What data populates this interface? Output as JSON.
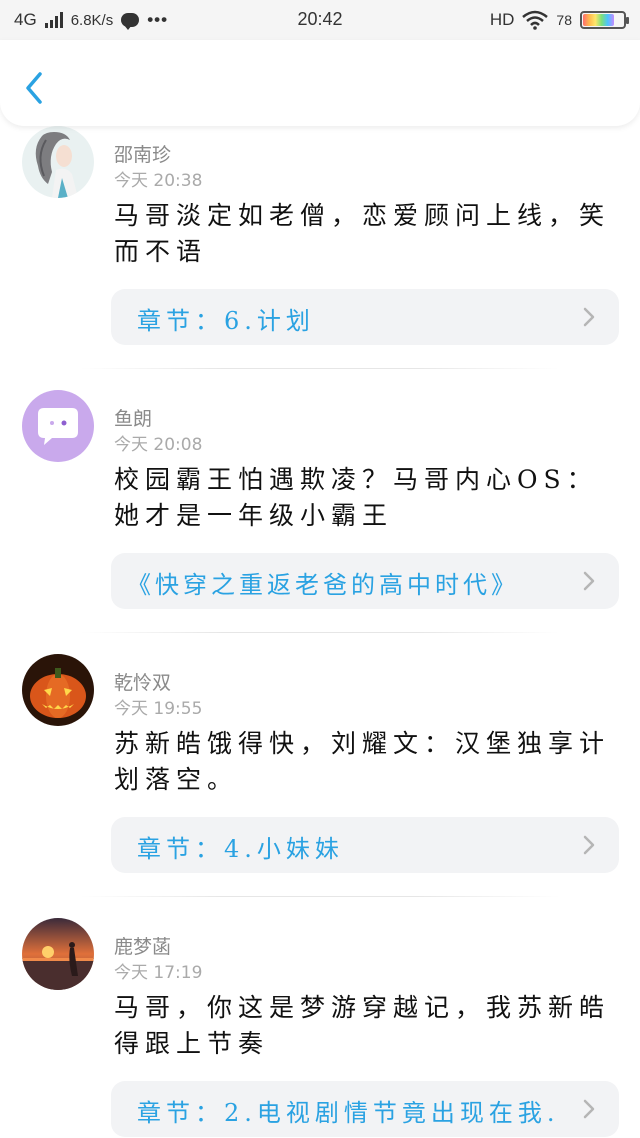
{
  "status_bar": {
    "network": "4G",
    "speed": "6.8K/s",
    "dots": "•••",
    "time": "20:42",
    "hd": "HD",
    "battery": "78"
  },
  "colors": {
    "link": "#2aa2e2",
    "back_arrow": "#2aa2e2",
    "link_bg": "#f2f3f5"
  },
  "comments": [
    {
      "username": "邵南珍",
      "time": "今天 20:38",
      "text": "马哥淡定如老僧，恋爱顾问上线，笑而不语",
      "link": "章节：6.计划",
      "avatar": "avatar-girl-gray-hair"
    },
    {
      "username": "鱼朗",
      "time": "今天 20:08",
      "text": "校园霸王怕遇欺凌？马哥内心OS：她才是一年级小霸王",
      "link": "《快穿之重返老爸的高中时代》",
      "avatar": "avatar-purple-chat"
    },
    {
      "username": "乾怜双",
      "time": "今天 19:55",
      "text": "苏新皓饿得快，刘耀文：汉堡独享计划落空。",
      "link": "章节：4.小妹妹",
      "avatar": "avatar-pumpkin"
    },
    {
      "username": "鹿梦菡",
      "time": "今天 17:19",
      "text": "马哥，你这是梦游穿越记，我苏新皓得跟上节奏",
      "link": "章节：2.电视剧情节竟出现在我...",
      "avatar": "avatar-sunset"
    }
  ]
}
